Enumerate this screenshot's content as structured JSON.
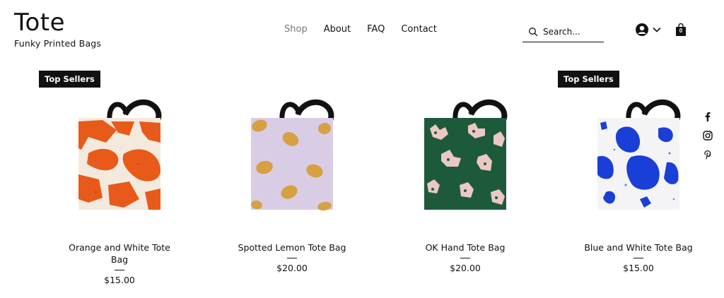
{
  "brand": {
    "title": "Tote",
    "subtitle": "Funky Printed Bags"
  },
  "nav": {
    "items": [
      "Shop",
      "About",
      "FAQ",
      "Contact"
    ],
    "active": "Shop"
  },
  "search": {
    "placeholder": "Search..."
  },
  "cart": {
    "count": "0"
  },
  "products": [
    {
      "badge": "Top Sellers",
      "name": "Orange and White Tote Bag",
      "price": "$15.00",
      "pattern": "orange-brush"
    },
    {
      "badge": "",
      "name": "Spotted Lemon Tote Bag",
      "price": "$20.00",
      "pattern": "lemons"
    },
    {
      "badge": "",
      "name": "OK Hand Tote Bag",
      "price": "$20.00",
      "pattern": "hands"
    },
    {
      "badge": "Top Sellers",
      "name": "Blue and White Tote Bag",
      "price": "$15.00",
      "pattern": "blue-blobs"
    }
  ],
  "colors": {
    "text": "#111111",
    "nav_active": "#777777",
    "badge_bg": "#111111"
  },
  "icons": [
    "search-icon",
    "account-icon",
    "chevron-down-icon",
    "cart-icon",
    "facebook-icon",
    "instagram-icon",
    "pinterest-icon"
  ]
}
